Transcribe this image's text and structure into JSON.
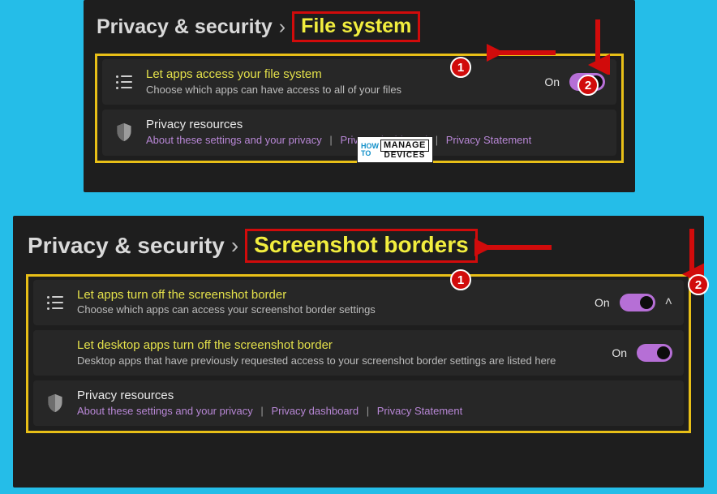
{
  "top": {
    "breadcrumb_root": "Privacy & security",
    "breadcrumb_sep": "›",
    "breadcrumb_current": "File system",
    "rows": {
      "access": {
        "title": "Let apps access your file system",
        "desc": "Choose which apps can have access to all of your files",
        "state_label": "On"
      },
      "privacy": {
        "title": "Privacy resources",
        "link1": "About these settings and your privacy",
        "link2": "Privacy dashboard",
        "link3": "Privacy Statement",
        "linksep": "|"
      }
    }
  },
  "bottom": {
    "breadcrumb_root": "Privacy & security",
    "breadcrumb_sep": "›",
    "breadcrumb_current": "Screenshot borders",
    "rows": {
      "r1": {
        "title": "Let apps turn off the screenshot border",
        "desc": "Choose which apps can access your screenshot border settings",
        "state_label": "On"
      },
      "r2": {
        "title": "Let desktop apps turn off the screenshot border",
        "desc": "Desktop apps that have previously requested access to your screenshot border settings are listed here",
        "state_label": "On"
      },
      "privacy": {
        "title": "Privacy resources",
        "link1": "About these settings and your privacy",
        "link2": "Privacy dashboard",
        "link3": "Privacy Statement",
        "linksep": "|"
      }
    }
  },
  "annotations": {
    "badge1": "1",
    "badge2": "2"
  },
  "watermark": {
    "how1": "HOW",
    "how2": "TO",
    "mg": "MANAGE",
    "dev": "DEVICES"
  }
}
